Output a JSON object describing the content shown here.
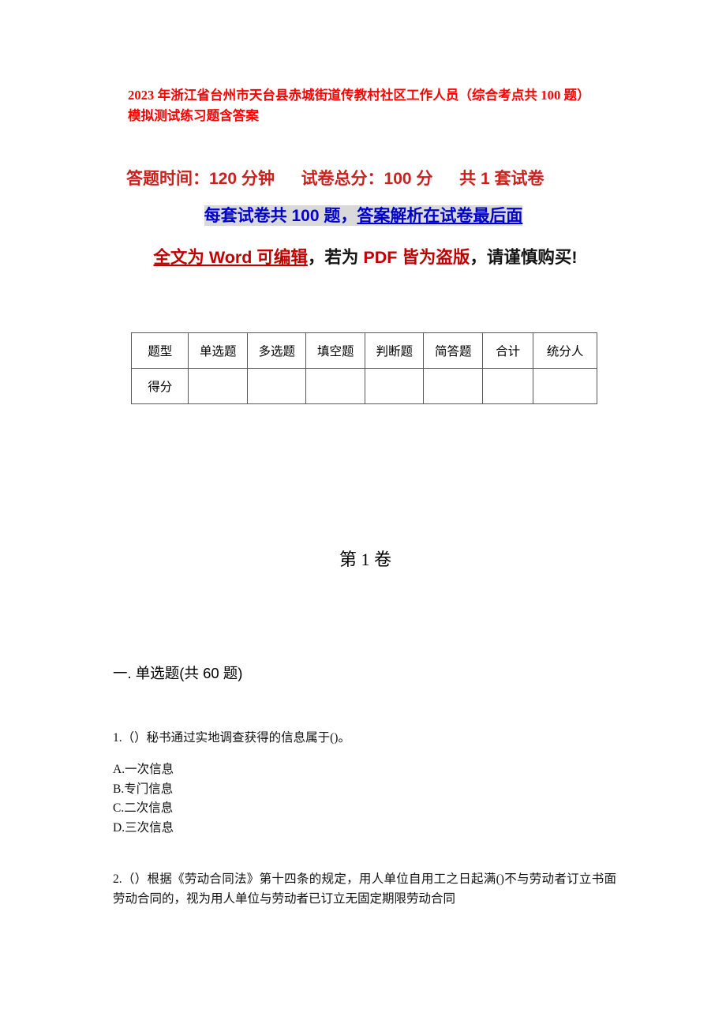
{
  "document": {
    "title_lines": [
      "2023 年浙江省台州市天台县赤城街道传教村社区工作人员（综合考点共 100",
      "题）模拟测试练习题含答案"
    ],
    "title_color": "#fe0000",
    "info_line": {
      "duration_label": "答题时间：120 分钟",
      "total_score_label": "试卷总分：100 分",
      "paper_count_label": "共 1 套试卷",
      "color": "#c9211e"
    },
    "highlight_line": {
      "plain_part": "每套试卷共 100 题，",
      "underlined_part": "答案解析在试卷最后面",
      "text_color": "#0000cc",
      "highlight_color": "#d9d9d9"
    },
    "warning_line": {
      "segment_red_underlined": "全文为 Word 可编辑",
      "segment_black_1": "，若为 ",
      "segment_red_bold": "PDF 皆为盗版",
      "segment_black_2": "，请谨慎购买!",
      "red_color": "#c00000",
      "black_color": "#151515"
    },
    "score_table": {
      "headers": [
        "题型",
        "单选题",
        "多选题",
        "填空题",
        "判断题",
        "简答题",
        "合计",
        "统分人"
      ],
      "rows": [
        {
          "label": "得分",
          "cells": [
            "",
            "",
            "",
            "",
            "",
            "",
            ""
          ]
        }
      ]
    },
    "volume_heading": "第 1 卷",
    "section_heading": "一. 单选题(共 60 题)",
    "questions": [
      {
        "stem": "1.（）秘书通过实地调查获得的信息属于()。",
        "options": [
          "A.一次信息",
          "B.专门信息",
          "C.二次信息",
          "D.三次信息"
        ]
      },
      {
        "stem": "2.（）根据《劳动合同法》第十四条的规定，用人单位自用工之日起满()不与劳动者订立书面劳动合同的，视为用人单位与劳动者已订立无固定期限劳动合同",
        "options": []
      }
    ]
  }
}
